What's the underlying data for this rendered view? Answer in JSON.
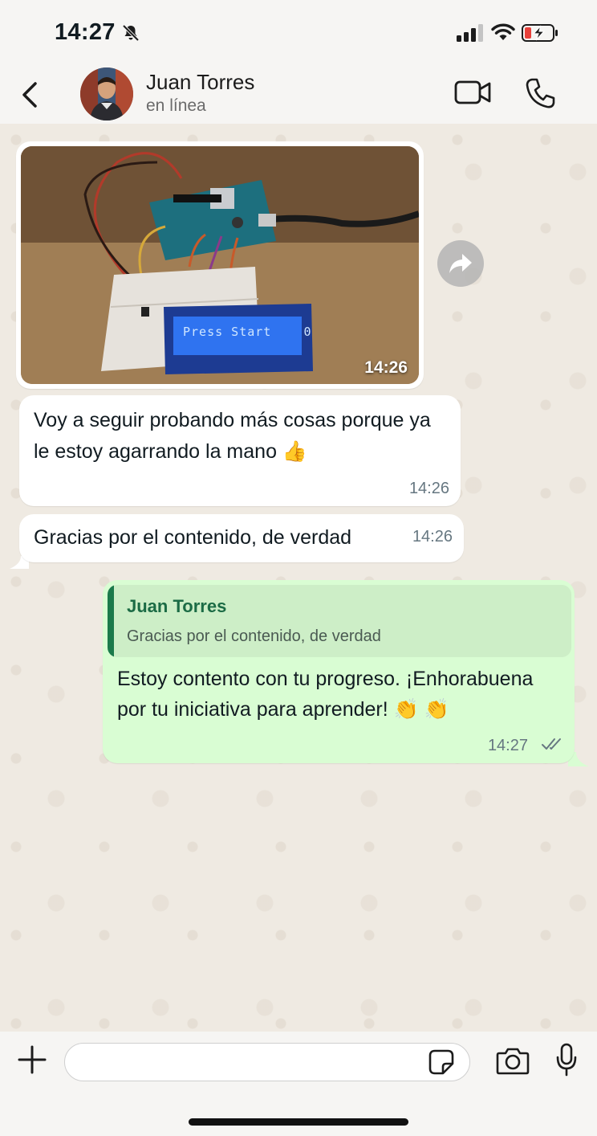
{
  "status_bar": {
    "time": "14:27",
    "icons": [
      "bell-slash-icon",
      "signal-icon",
      "wifi-icon",
      "battery-charging-icon"
    ]
  },
  "header": {
    "contact_name": "Juan Torres",
    "contact_status": "en línea",
    "icons": [
      "back-icon",
      "video-call-icon",
      "phone-call-icon"
    ]
  },
  "messages": [
    {
      "type": "image",
      "direction": "incoming",
      "lcd_text": "Press Start    0",
      "time": "14:26"
    },
    {
      "type": "text",
      "direction": "incoming",
      "text": "Voy a seguir probando más cosas porque ya le estoy agarrando la mano 👍",
      "time": "14:26"
    },
    {
      "type": "text",
      "direction": "incoming",
      "text": "Gracias por el contenido, de verdad",
      "time": "14:26"
    },
    {
      "type": "reply",
      "direction": "outgoing",
      "quote_name": "Juan Torres",
      "quote_text": "Gracias por el contenido, de verdad",
      "text": "Estoy contento con tu progreso. ¡Enhorabuena por tu iniciativa para aprender! 👏 👏",
      "time": "14:27",
      "status": "read"
    }
  ],
  "composer": {
    "placeholder": "",
    "icons": [
      "plus-icon",
      "sticker-icon",
      "camera-icon",
      "microphone-icon"
    ]
  },
  "colors": {
    "chat_background": "#efeae2",
    "incoming_bubble": "#ffffff",
    "outgoing_bubble": "#d9fdd3",
    "quote_accent": "#1b7a4b"
  }
}
